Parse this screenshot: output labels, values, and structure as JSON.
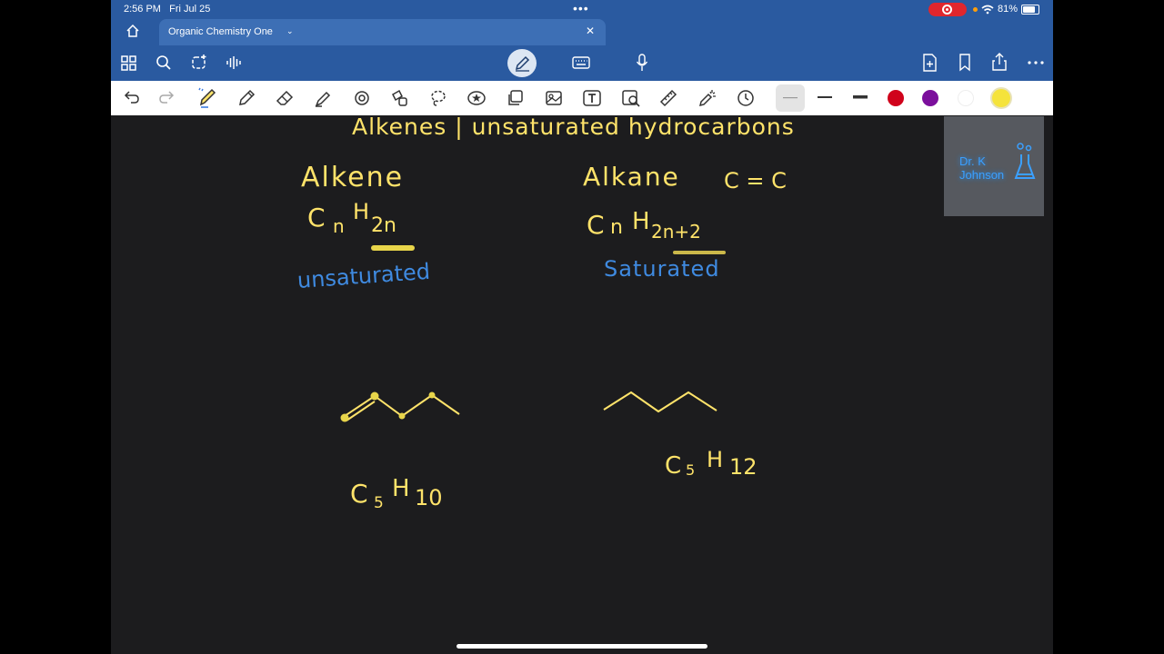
{
  "status": {
    "time": "2:56 PM",
    "date": "Fri Jul 25",
    "battery": "81%"
  },
  "tab": {
    "title": "Organic Chemistry One"
  },
  "toolbar": {
    "left_icons": [
      "grid-icon",
      "search-icon",
      "lasso-select-icon",
      "audio-icon"
    ],
    "center_icons": [
      "pen-mode-icon",
      "keyboard-icon",
      "microphone-icon"
    ],
    "right_icons": [
      "add-page-icon",
      "bookmark-icon",
      "share-icon",
      "more-icon"
    ]
  },
  "tools": {
    "icons": [
      "undo-icon",
      "redo-icon",
      "pen-icon",
      "pencil-icon",
      "eraser-icon",
      "highlighter-icon",
      "shapes-icon",
      "elements-icon",
      "lasso-icon",
      "sticker-icon",
      "image-icon",
      "camera-icon",
      "text-icon",
      "scan-icon",
      "ruler-icon",
      "laser-pointer-icon",
      "timer-icon"
    ],
    "colors": [
      "#d0021b",
      "#7b0f9c",
      "#ffffff",
      "#f5e33b"
    ]
  },
  "note": {
    "heading": "Alkenes | unsaturated hydrocarbons",
    "alkene_label": "Alkene",
    "alkene_formula_c": "C",
    "alkene_formula_n": "n",
    "alkene_formula_h": "H",
    "alkene_formula_2n": "2n",
    "alkene_note": "unsaturated",
    "alkane_label": "Alkane",
    "double_bond": "C = C",
    "alkane_formula_c": "C",
    "alkane_formula_n": "n",
    "alkane_formula_h": "H",
    "alkane_formula_sub": "2n+2",
    "alkane_note": "Saturated",
    "alkene_molecule_formula": "C",
    "alkene_molecule_sub1": "5",
    "alkene_molecule_h": "H",
    "alkene_molecule_sub2": "10",
    "alkane_molecule_formula": "C",
    "alkane_molecule_sub1": "5",
    "alkane_molecule_h": "H",
    "alkane_molecule_sub2": "12"
  },
  "logo": {
    "line1": "Dr. K",
    "line2": "Johnson"
  }
}
